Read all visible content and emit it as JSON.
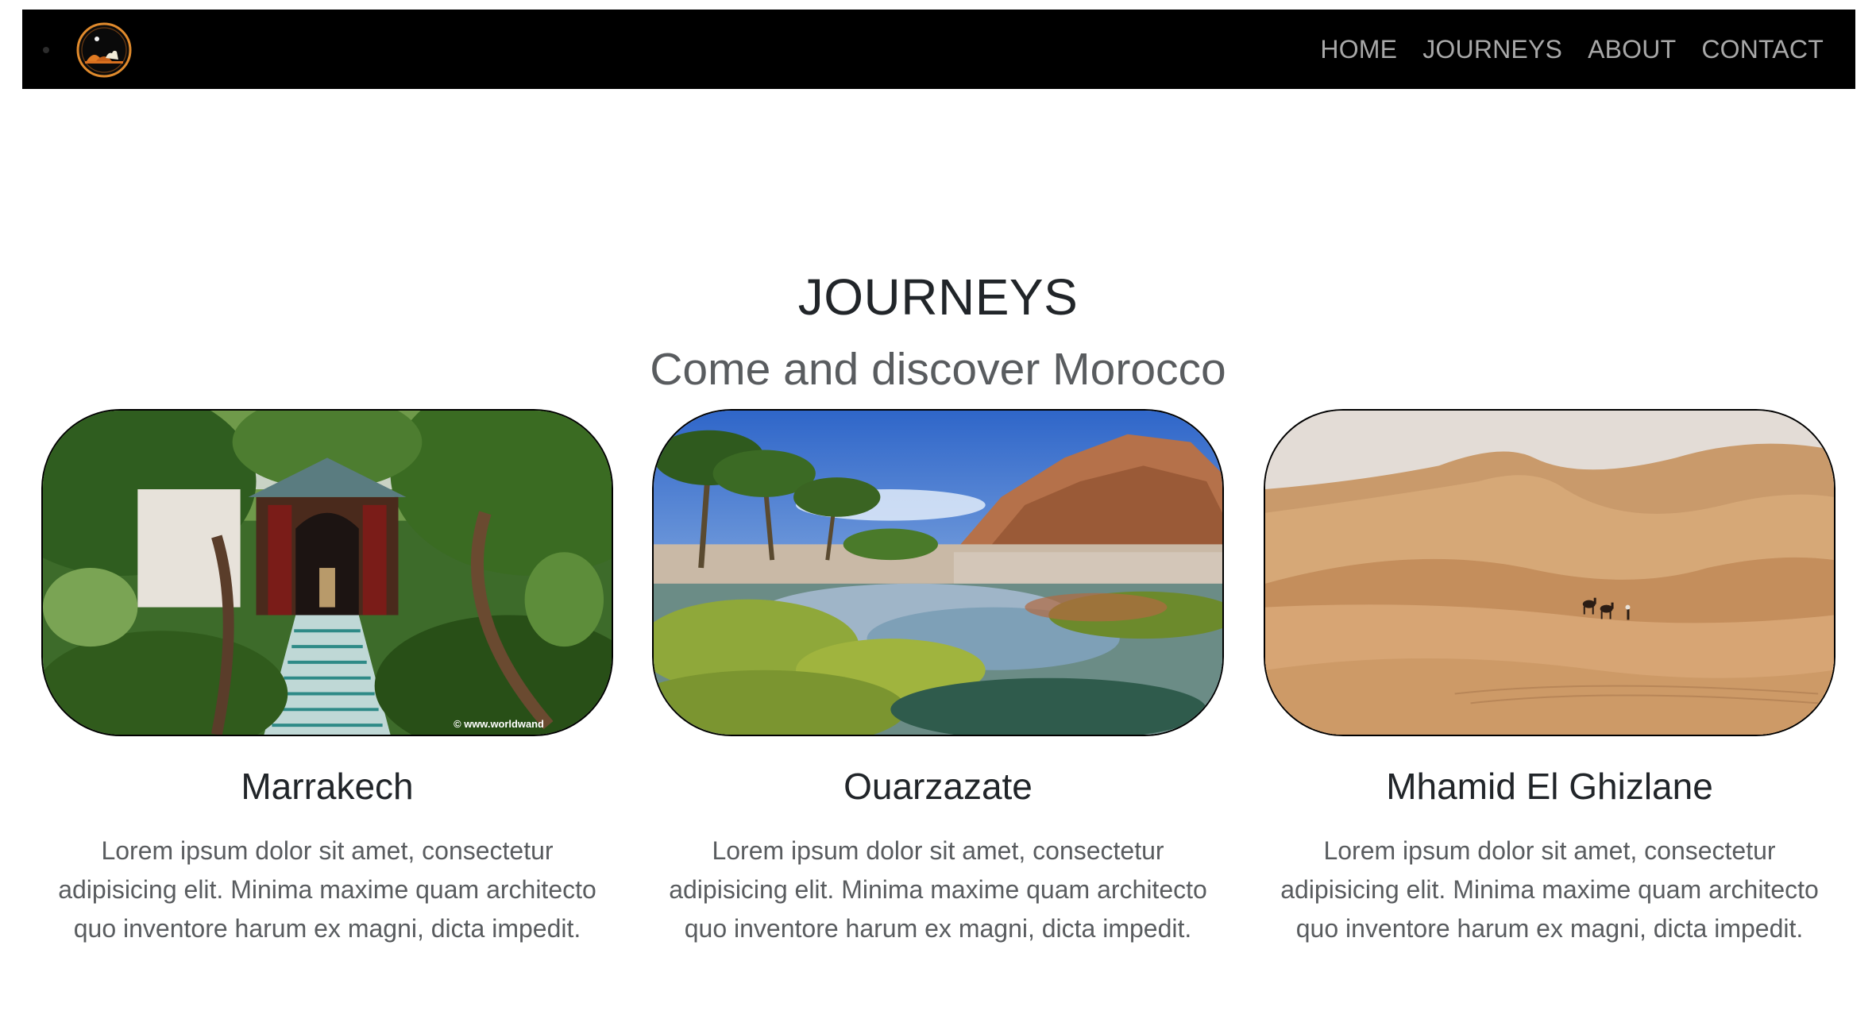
{
  "navbar": {
    "logo_name": "camel-desert-logo",
    "links": [
      {
        "label": "HOME"
      },
      {
        "label": "JOURNEYS"
      },
      {
        "label": "ABOUT"
      },
      {
        "label": "CONTACT"
      }
    ]
  },
  "section": {
    "title": "JOURNEYS",
    "subtitle": "Come and discover Morocco"
  },
  "cards": [
    {
      "title": "Marrakech",
      "text": "Lorem ipsum dolor sit amet, consectetur adipisicing elit. Minima maxime quam architecto quo inventore harum ex magni, dicta impedit.",
      "image_watermark": "© www.worldwand"
    },
    {
      "title": "Ouarzazate",
      "text": "Lorem ipsum dolor sit amet, consectetur adipisicing elit. Minima maxime quam architecto quo inventore harum ex magni, dicta impedit."
    },
    {
      "title": "Mhamid El Ghizlane",
      "text": "Lorem ipsum dolor sit amet, consectetur adipisicing elit. Minima maxime quam architecto quo inventore harum ex magni, dicta impedit."
    }
  ],
  "colors": {
    "navbar_bg": "#000000",
    "nav_link": "#a8a8a8",
    "heading": "#212529",
    "muted_text": "#595c5f"
  }
}
